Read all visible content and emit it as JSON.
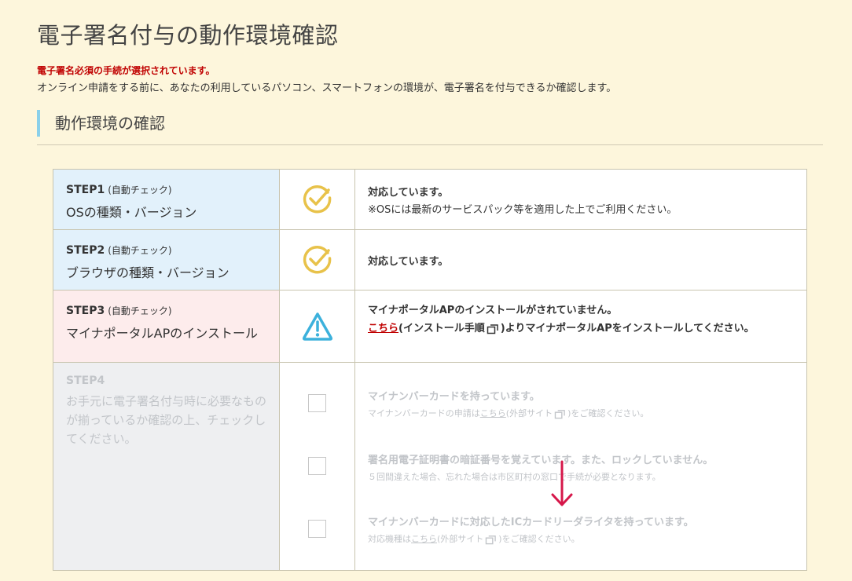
{
  "page": {
    "title": "電子署名付与の動作環境確認",
    "notice": "電子署名必須の手続が選択されています。",
    "intro": "オンライン申請をする前に、あなたの利用しているパソコン、スマートフォンの環境が、電子署名を付与できるか確認します。",
    "section_heading": "動作環境の確認"
  },
  "steps": [
    {
      "label": "STEP1",
      "auto": "(自動チェック)",
      "desc": "OSの種類・バージョン",
      "status_icon": "check-circle-icon",
      "message": "対応しています。",
      "note": "※OSには最新のサービスパック等を適用した上でご利用ください。"
    },
    {
      "label": "STEP2",
      "auto": "(自動チェック)",
      "desc": "ブラウザの種類・バージョン",
      "status_icon": "check-circle-icon",
      "message": "対応しています。"
    },
    {
      "label": "STEP3",
      "auto": "(自動チェック)",
      "desc": "マイナポータルAPのインストール",
      "status_icon": "warning-triangle-icon",
      "message": "マイナポータルAPのインストールがされていません。",
      "link": "こちら",
      "link_paren_open": "(インストール手順",
      "link_paren_close": ")",
      "link_after": "よりマイナポータルAPをインストールしてください。"
    }
  ],
  "step4": {
    "label": "STEP4",
    "desc": "お手元に電子署名付与時に必要なものが揃っているか確認の上、チェックしてください。",
    "items": [
      {
        "title": "マイナンバーカードを持っています。",
        "note_prefix": "マイナンバーカードの申請は",
        "link": "こちら",
        "note_mid": "(外部サイト",
        "note_suffix": ")をご確認ください。"
      },
      {
        "title": "署名用電子証明書の暗証番号を覚えています。また、ロックしていません。",
        "note": "５回間違えた場合、忘れた場合は市区町村の窓口で手続が必要となります。"
      },
      {
        "title": "マイナンバーカードに対応したICカードリーダライタを持っています。",
        "note_prefix": "対応機種は",
        "link": "こちら",
        "note_mid": "(外部サイト",
        "note_suffix": ")をご確認ください。"
      }
    ]
  },
  "colors": {
    "background": "#fdf6dc",
    "notice_red": "#c00000",
    "check_yellow": "#e8c24a",
    "warning_blue": "#3cb1dc",
    "arrow_red": "#d6174a"
  }
}
